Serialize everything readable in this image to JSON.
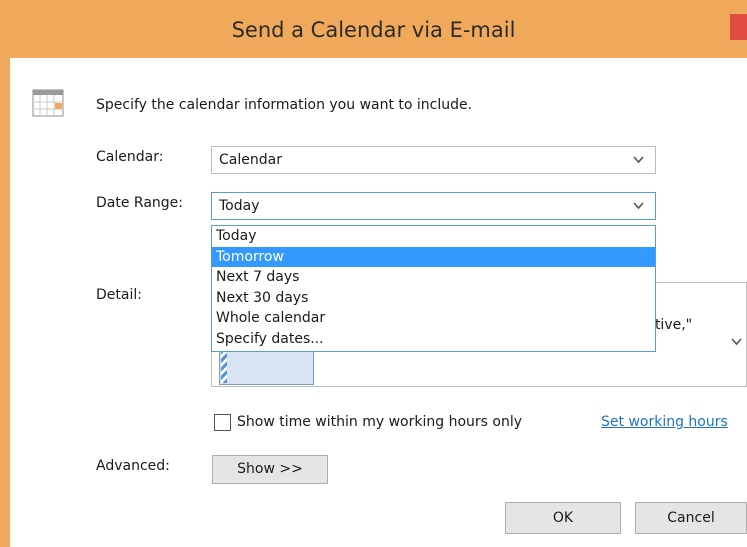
{
  "window": {
    "title": "Send a Calendar via E-mail"
  },
  "intro_text": "Specify the calendar information you want to include.",
  "calendar": {
    "label": "Calendar:",
    "value": "Calendar"
  },
  "date_range": {
    "label": "Date Range:",
    "value": "Today",
    "options": [
      "Today",
      "Tomorrow",
      "Next 7 days",
      "Next 30 days",
      "Whole calendar",
      "Specify dates..."
    ],
    "highlighted": "Tomorrow"
  },
  "detail": {
    "label": "Detail:",
    "visible_text": "ntative,\""
  },
  "working_hours": {
    "checkbox_label": "Show time within my working hours only",
    "checked": false,
    "link_text": "Set working hours"
  },
  "advanced": {
    "label": "Advanced:",
    "button_label": "Show >>"
  },
  "buttons": {
    "ok": "OK",
    "cancel": "Cancel"
  },
  "colors": {
    "title_bar": "#f0a95a",
    "selection": "#3399ff",
    "link": "#1e73c8"
  }
}
